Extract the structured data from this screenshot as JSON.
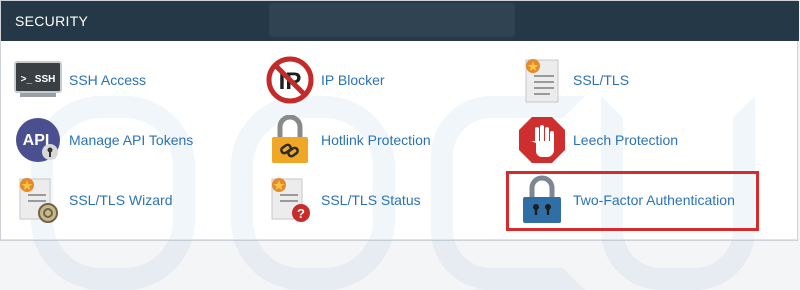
{
  "section": {
    "title": "SECURITY"
  },
  "items": [
    {
      "label": "SSH Access",
      "icon": "terminal-icon",
      "icon_text": ">_ SSH"
    },
    {
      "label": "IP Blocker",
      "icon": "ip-blocker-icon",
      "icon_text": "IP"
    },
    {
      "label": "SSL/TLS",
      "icon": "certificate-icon"
    },
    {
      "label": "Manage API Tokens",
      "icon": "api-key-icon",
      "icon_text": "API"
    },
    {
      "label": "Hotlink Protection",
      "icon": "chain-lock-icon"
    },
    {
      "label": "Leech Protection",
      "icon": "stop-hand-icon"
    },
    {
      "label": "SSL/TLS Wizard",
      "icon": "certificate-wizard-icon"
    },
    {
      "label": "SSL/TLS Status",
      "icon": "certificate-status-icon"
    },
    {
      "label": "Two-Factor Authentication",
      "icon": "padlock-icon",
      "highlighted": true
    }
  ],
  "colors": {
    "header_bg": "#243848",
    "link": "#2a73b6",
    "highlight": "#d52b2b"
  }
}
